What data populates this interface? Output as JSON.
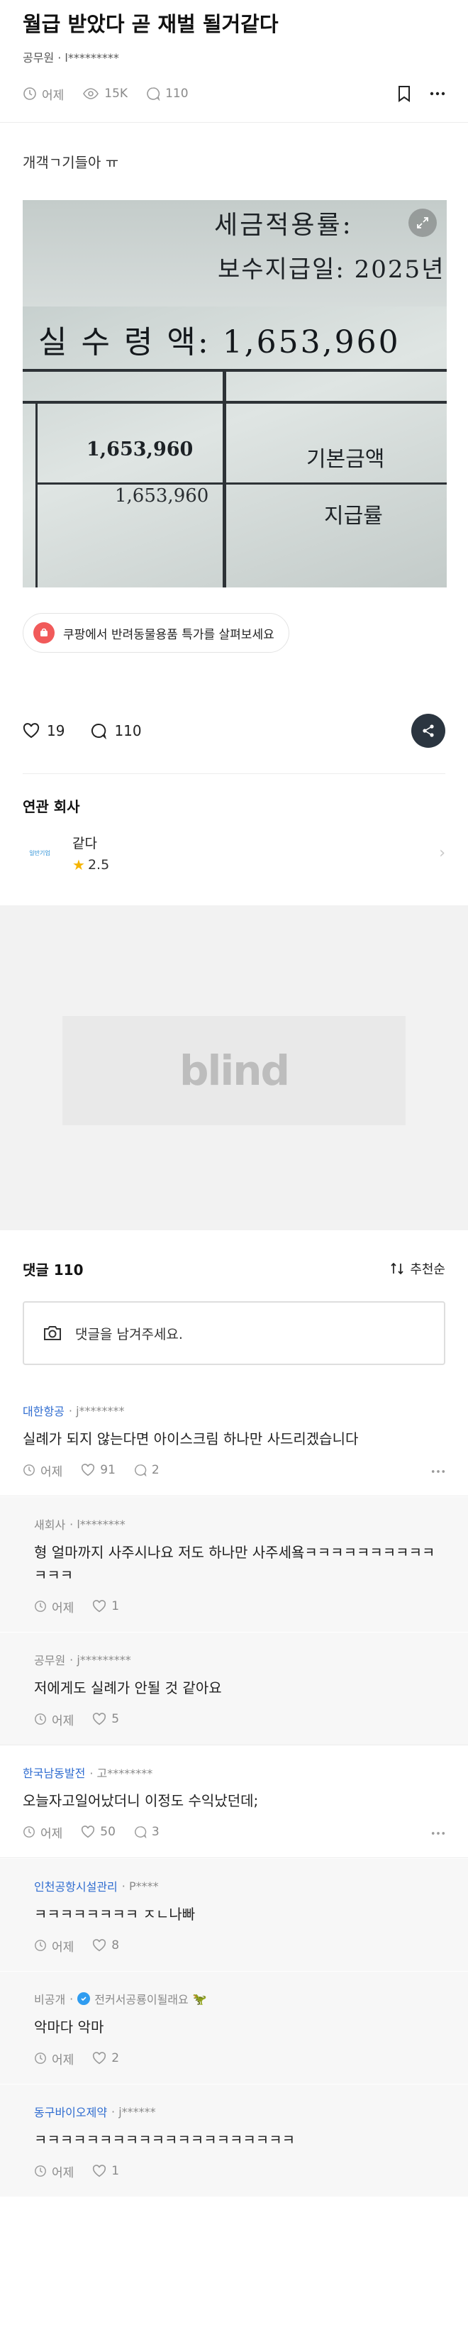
{
  "post": {
    "title": "월급 받았다 곧 재벌 될거같다",
    "author": "공무원 · l*********",
    "time": "어제",
    "views": "15K",
    "comments_count": "110",
    "body": "개객ㄱ기들아 ㅠ"
  },
  "photo": {
    "line1": "세금적용률:",
    "line2": "보수지급일: 2025년",
    "line3": "실 수 령 액: 1,653,960",
    "cell1": "1,653,960",
    "cell2": "1,653,960",
    "label1": "기본금액",
    "label2": "지급률"
  },
  "ad_chip": {
    "label": "쿠팡에서 반려동물용품 특가를 살펴보세요"
  },
  "reactions": {
    "likes": "19",
    "comments": "110"
  },
  "related": {
    "title": "연관 회사",
    "company_name": "같다",
    "rating": "2.5",
    "logo_text": "일반기업"
  },
  "ad": {
    "brand": "blind"
  },
  "comments_section": {
    "title": "댓글 110",
    "sort_label": "추천순",
    "input_placeholder": "댓글을 남겨주세요."
  },
  "comments": [
    {
      "company": "대한항공",
      "user": "· j********",
      "text": "실례가 되지 않는다면 아이스크림 하나만 사드리겠습니다",
      "time": "어제",
      "likes": "91",
      "replies": "2",
      "reply": false
    },
    {
      "company": "새회사",
      "user": "· l********",
      "text": "형 얼마까지 사주시나요 저도 하나만 사주세욬ㅋㅋㅋㅋㅋㅋㅋㅋㅋㅋㅋㅋㅋ",
      "time": "어제",
      "likes": "1",
      "replies": "",
      "reply": true
    },
    {
      "company": "공무원",
      "user": "· j*********",
      "text": "저에게도 실례가 안될 것 같아요",
      "time": "어제",
      "likes": "5",
      "replies": "",
      "reply": true
    },
    {
      "company": "한국남동발전",
      "user": "· 고********",
      "text": "오늘자고일어났더니 이정도 수익났던데;",
      "time": "어제",
      "likes": "50",
      "replies": "3",
      "reply": false
    },
    {
      "company": "인천공항시설관리",
      "user": "· P****",
      "text": "ㅋㅋㅋㅋㅋㅋㅋㅋ ㅈㄴ나빠",
      "time": "어제",
      "likes": "8",
      "replies": "",
      "reply": true
    },
    {
      "company": "비공개",
      "user": "전커서공룡이될래요",
      "text": "악마다 악마",
      "time": "어제",
      "likes": "2",
      "replies": "",
      "reply": true
    },
    {
      "company": "동구바이오제약",
      "user": "· j******",
      "text": "ㅋㅋㅋㅋㅋㅋㅋㅋㅋㅋㅋㅋㅋㅋㅋㅋㅋㅋㅋㅋ",
      "time": "어제",
      "likes": "1",
      "replies": "",
      "reply": true
    }
  ],
  "colors": {
    "link_blue": "#2f6cd0",
    "share_bg": "#2b3540",
    "star": "#f5b400"
  }
}
